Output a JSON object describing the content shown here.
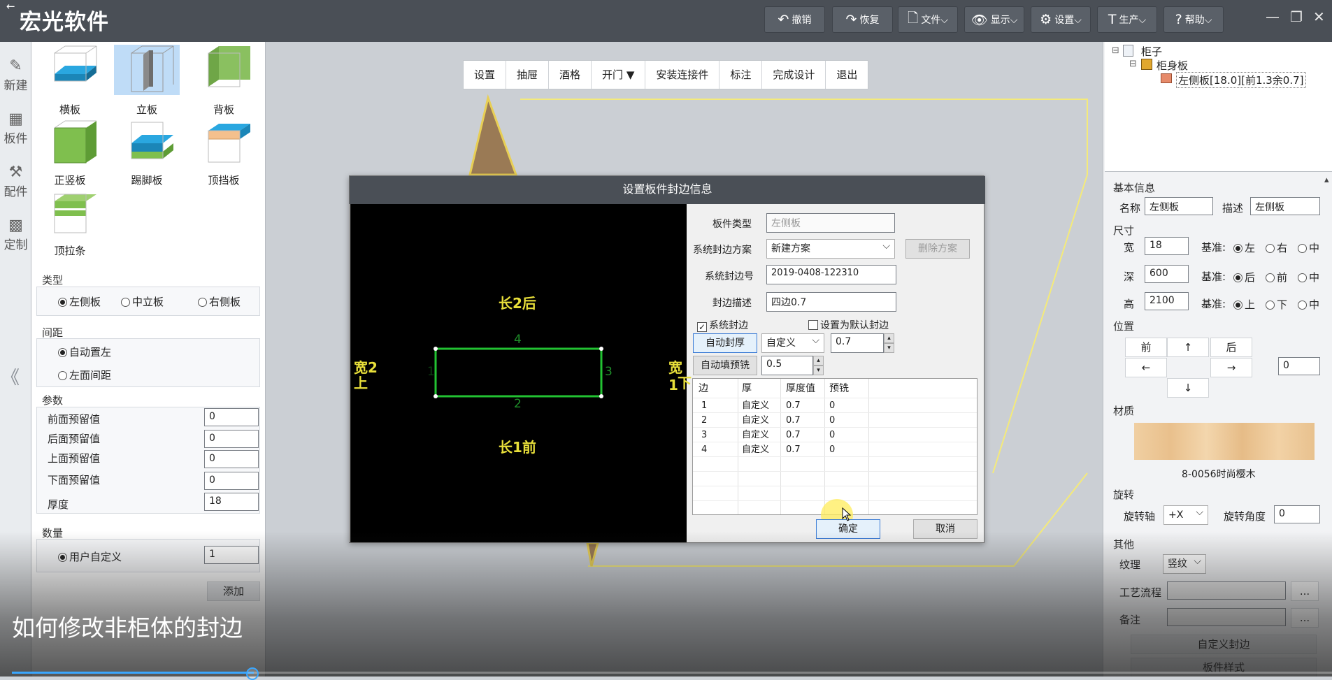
{
  "app": {
    "title": "宏光软件",
    "back": "←"
  },
  "toolbar": [
    {
      "icon": "↶",
      "label": "撤销"
    },
    {
      "icon": "↷",
      "label": "恢复"
    },
    {
      "icon": "🗋",
      "label": "文件⌵"
    },
    {
      "icon": "👁",
      "label": "显示⌵"
    },
    {
      "icon": "⚙",
      "label": "设置⌵"
    },
    {
      "icon": "T",
      "label": "生产⌵"
    },
    {
      "icon": "?",
      "label": "帮助⌵"
    }
  ],
  "window_controls": {
    "min": "—",
    "restore": "❐",
    "close": "✕"
  },
  "left_strip": [
    {
      "icon": "✎",
      "label": "新建"
    },
    {
      "icon": "▦",
      "label": "板件"
    },
    {
      "icon": "⚒",
      "label": "配件"
    },
    {
      "icon": "▩",
      "label": "定制"
    }
  ],
  "panel_tiles": [
    "横板",
    "立板",
    "背板",
    "正竖板",
    "踢脚板",
    "顶挡板",
    "顶拉条"
  ],
  "type_section": {
    "title": "类型",
    "options": [
      "左侧板",
      "中立板",
      "右侧板"
    ],
    "selected": 0
  },
  "spacing_section": {
    "title": "间距",
    "options": [
      "自动置左",
      "左面间距"
    ],
    "selected": 0
  },
  "params_section": {
    "title": "参数",
    "rows": [
      {
        "label": "前面预留值",
        "value": "0"
      },
      {
        "label": "后面预留值",
        "value": "0"
      },
      {
        "label": "上面预留值",
        "value": "0"
      },
      {
        "label": "下面预留值",
        "value": "0"
      },
      {
        "label": "厚度",
        "value": "18"
      }
    ]
  },
  "qty_section": {
    "title": "数量",
    "option": "用户自定义",
    "value": "1"
  },
  "add_button": "添加",
  "collapse_arrow": "《",
  "design_toolbar": [
    "设置",
    "抽屉",
    "酒格",
    "开门 ▼",
    "安装连接件",
    "标注",
    "完成设计",
    "退出"
  ],
  "tree": {
    "root": "柜子",
    "child": "柜身板",
    "leaf": "左侧板[18.0][前1.3余0.7]",
    "expander": "⊟"
  },
  "right_panel": {
    "basic_title": "基本信息",
    "name_label": "名称",
    "name_value": "左侧板",
    "desc_label": "描述",
    "desc_value": "左侧板",
    "size_title": "尺寸",
    "size_rows": [
      {
        "label": "宽",
        "value": "18",
        "base": "基准:",
        "opts": [
          "左",
          "右",
          "中"
        ]
      },
      {
        "label": "深",
        "value": "600",
        "base": "基准:",
        "opts": [
          "后",
          "前",
          "中"
        ]
      },
      {
        "label": "高",
        "value": "2100",
        "base": "基准:",
        "opts": [
          "上",
          "下",
          "中"
        ]
      }
    ],
    "pos_title": "位置",
    "pos_buttons": {
      "front": "前",
      "up": "↑",
      "back": "后",
      "left": "←",
      "right": "→",
      "down": "↓"
    },
    "pos_value": "0",
    "material_title": "材质",
    "material_name": "8-0056时尚樱木",
    "rotate_title": "旋转",
    "rotate_axis_label": "旋转轴",
    "rotate_axis_value": "+X",
    "rotate_angle_label": "旋转角度",
    "rotate_angle_value": "0",
    "other_title": "其他",
    "grain_label": "纹理",
    "grain_value": "竖纹",
    "process_label": "工艺流程",
    "note_label": "备注",
    "ellipsis": "...",
    "custom_edge_button": "自定义封边",
    "panel_style_button": "板件样式",
    "scroll_up": "▴"
  },
  "dialog": {
    "title": "设置板件封边信息",
    "canvas_labels": {
      "top": "长2后",
      "bottom": "长1前",
      "left1": "宽2",
      "left2": "上",
      "right1": "宽1",
      "right2": "下",
      "edge_top": "4",
      "edge_bottom": "2",
      "edge_right": "3",
      "edge_left": "1"
    },
    "panel_type_label": "板件类型",
    "panel_type_value": "左侧板",
    "scheme_label": "系统封边方案",
    "scheme_value": "新建方案",
    "delete_scheme": "删除方案",
    "edge_no_label": "系统封边号",
    "edge_no_value": "2019-0408-122310",
    "edge_desc_label": "封边描述",
    "edge_desc_value": "四边0.7",
    "sys_edge_label": "系统封边",
    "default_edge_label": "设置为默认封边",
    "auto_thick_button": "自动封厚",
    "auto_thick_mode": "自定义",
    "auto_thick_value": "0.7",
    "auto_trim_button": "自动填预铣",
    "auto_trim_value": "0.5",
    "grid_headers": [
      "边",
      "厚",
      "厚度值",
      "预铣"
    ],
    "grid_rows": [
      [
        "1",
        "自定义",
        "0.7",
        "0"
      ],
      [
        "2",
        "自定义",
        "0.7",
        "0"
      ],
      [
        "3",
        "自定义",
        "0.7",
        "0"
      ],
      [
        "4",
        "自定义",
        "0.7",
        "0"
      ]
    ],
    "ok_button": "确定",
    "cancel_button": "取消",
    "spin_up": "▴",
    "spin_down": "▾"
  },
  "caption": "如何修改非柜体的封边"
}
